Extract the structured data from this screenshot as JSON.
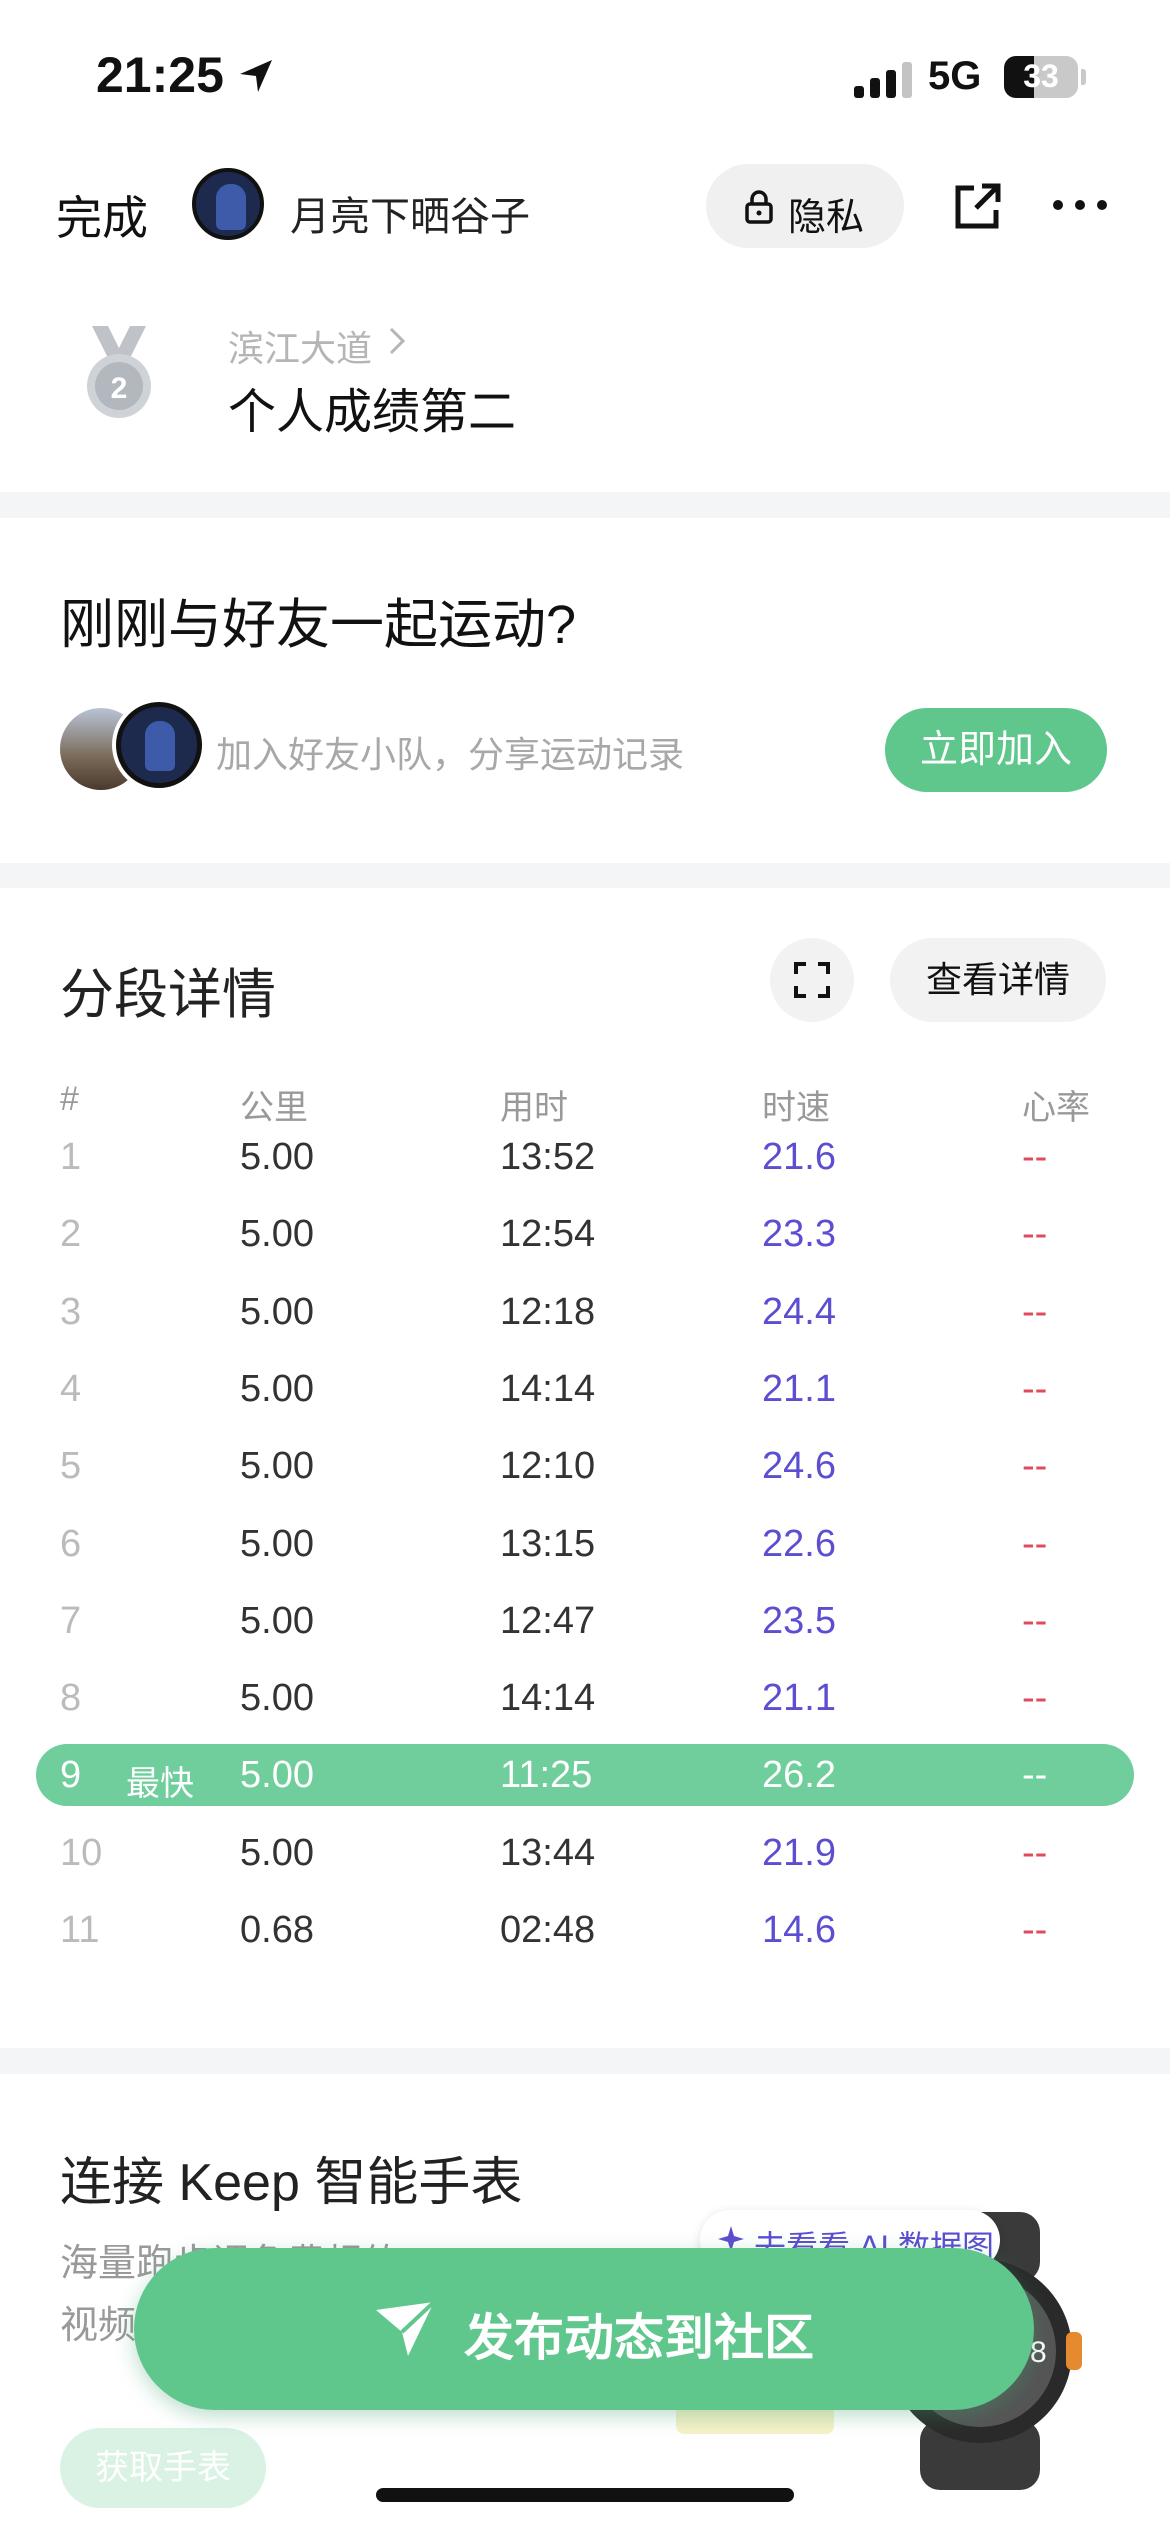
{
  "status_bar": {
    "time": "21:25",
    "network": "5G",
    "battery": "33"
  },
  "header": {
    "done_label": "完成",
    "username": "月亮下晒谷子",
    "privacy_label": "隐私"
  },
  "achievement": {
    "route": "滨江大道",
    "title": "个人成绩第二",
    "medal_number": "2"
  },
  "friends": {
    "title": "刚刚与好友一起运动?",
    "subtitle": "加入好友小队，分享运动记录",
    "join_label": "立即加入"
  },
  "splits": {
    "title": "分段详情",
    "detail_label": "查看详情",
    "columns": [
      "#",
      "公里",
      "用时",
      "时速",
      "心率"
    ],
    "best_tag": "最快",
    "rows": [
      {
        "idx": "1",
        "km": "5.00",
        "time": "13:52",
        "speed": "21.6",
        "hr": "--"
      },
      {
        "idx": "2",
        "km": "5.00",
        "time": "12:54",
        "speed": "23.3",
        "hr": "--"
      },
      {
        "idx": "3",
        "km": "5.00",
        "time": "12:18",
        "speed": "24.4",
        "hr": "--"
      },
      {
        "idx": "4",
        "km": "5.00",
        "time": "14:14",
        "speed": "21.1",
        "hr": "--"
      },
      {
        "idx": "5",
        "km": "5.00",
        "time": "12:10",
        "speed": "24.6",
        "hr": "--"
      },
      {
        "idx": "6",
        "km": "5.00",
        "time": "13:15",
        "speed": "22.6",
        "hr": "--"
      },
      {
        "idx": "7",
        "km": "5.00",
        "time": "12:47",
        "speed": "23.5",
        "hr": "--"
      },
      {
        "idx": "8",
        "km": "5.00",
        "time": "14:14",
        "speed": "21.1",
        "hr": "--"
      },
      {
        "idx": "9",
        "km": "5.00",
        "time": "11:25",
        "speed": "26.2",
        "hr": "--",
        "best": true
      },
      {
        "idx": "10",
        "km": "5.00",
        "time": "13:44",
        "speed": "21.9",
        "hr": "--"
      },
      {
        "idx": "11",
        "km": "0.68",
        "time": "02:48",
        "speed": "14.6",
        "hr": "--"
      }
    ]
  },
  "watch": {
    "title": "连接 Keep 智能手表",
    "subtitle_line1": "海量跑步课免费畅练",
    "subtitle_line2": "视频",
    "get_label": "获取手表"
  },
  "ai_pill": {
    "label": "去看看 AI 数据图"
  },
  "publish": {
    "label": "发布动态到社区"
  },
  "colors": {
    "accent_green": "#5fc68c",
    "best_row_green": "#6fce9c",
    "speed_purple": "#5b4ed1",
    "hr_red": "#e04a5a"
  }
}
